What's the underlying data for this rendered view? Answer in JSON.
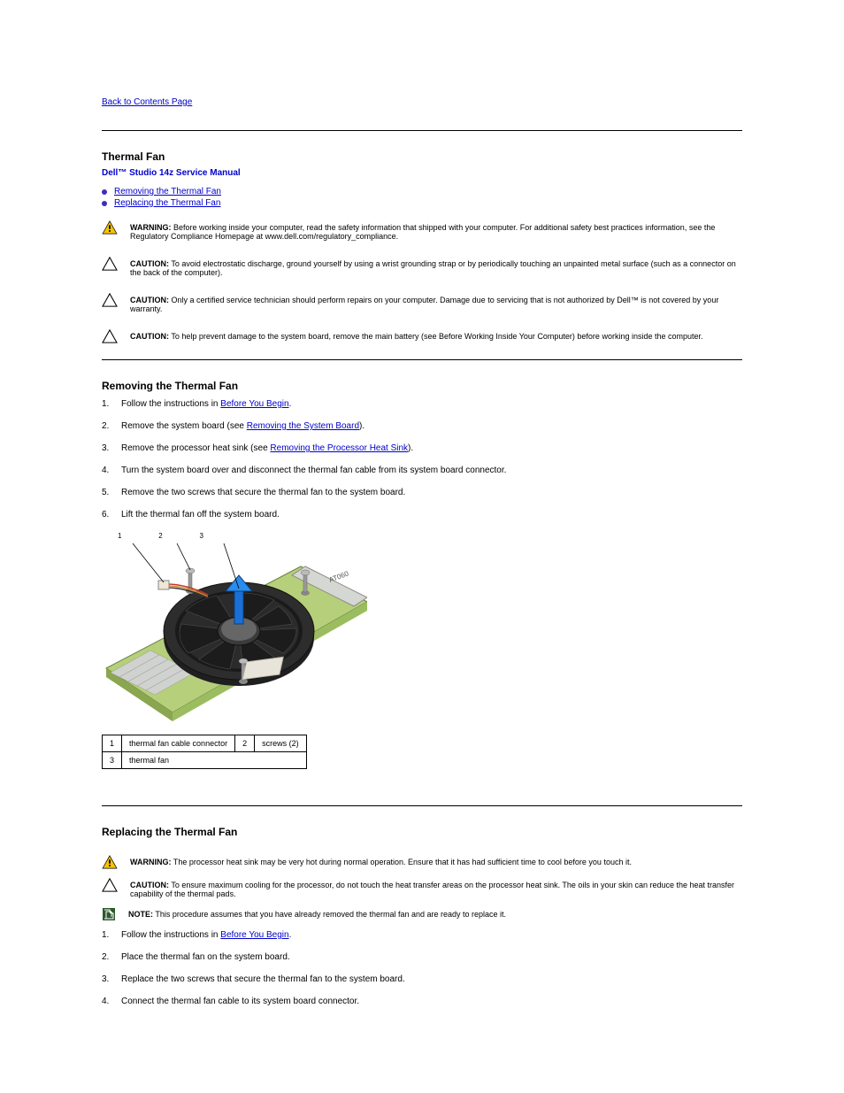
{
  "nav": {
    "back": "Back to Contents Page"
  },
  "header": {
    "page_title": "Thermal Fan",
    "manual": "Dell™ Studio 14z Service Manual"
  },
  "toc": {
    "items": [
      {
        "label": "Removing the Thermal Fan"
      },
      {
        "label": "Replacing the Thermal Fan"
      }
    ]
  },
  "alerts": {
    "warn1": {
      "lead": "WARNING:",
      "body": "Before working inside your computer, read the safety information that shipped with your computer. For additional safety best practices information, see the Regulatory Compliance Homepage at www.dell.com/regulatory_compliance."
    },
    "caution1": {
      "lead": "CAUTION:",
      "body": "To avoid electrostatic discharge, ground yourself by using a wrist grounding strap or by periodically touching an unpainted metal surface (such as a connector on the back of the computer)."
    },
    "caution2": {
      "lead": "CAUTION:",
      "body": "Only a certified service technician should perform repairs on your computer. Damage due to servicing that is not authorized by Dell™ is not covered by your warranty."
    },
    "caution3": {
      "lead": "CAUTION:",
      "body": "To help prevent damage to the system board, remove the main battery (see Before Working Inside Your Computer) before working inside the computer."
    },
    "warn2": {
      "lead": "WARNING:",
      "body": "The processor heat sink may be very hot during normal operation. Ensure that it has had sufficient time to cool before you touch it."
    },
    "caution4": {
      "lead": "CAUTION:",
      "body": "To ensure maximum cooling for the processor, do not touch the heat transfer areas on the processor heat sink. The oils in your skin can reduce the heat transfer capability of the thermal pads."
    },
    "note1": {
      "lead": "NOTE:",
      "body": "This procedure assumes that you have already removed the thermal fan and are ready to replace it."
    }
  },
  "section1": {
    "title": "Removing the Thermal Fan",
    "steps": [
      {
        "num": "1.",
        "pre": "Follow the instructions in ",
        "link": "Before You Begin",
        "post": "."
      },
      {
        "num": "2.",
        "pre": "Remove the system board (see ",
        "link": "Removing the System Board",
        "post": ")."
      },
      {
        "num": "3.",
        "pre": "Remove the processor heat sink (see ",
        "link": "Removing the Processor Heat Sink",
        "post": ")."
      },
      {
        "num": "4.",
        "pre": "Turn the system board over and disconnect the thermal fan cable from its system board connector."
      },
      {
        "num": "5.",
        "pre": "Remove the two screws that secure the thermal fan to the system board."
      },
      {
        "num": "6.",
        "pre": "Lift the thermal fan off the system board."
      }
    ]
  },
  "legend": {
    "rows": [
      [
        "1",
        "thermal fan cable connector",
        "2",
        "screws (2)"
      ],
      [
        "3",
        "thermal fan",
        "",
        ""
      ]
    ]
  },
  "callouts": {
    "c1": "1",
    "c2": "2",
    "c3": "3"
  },
  "section2": {
    "title": "Replacing the Thermal Fan",
    "steps": [
      {
        "num": "1.",
        "pre": "Follow the instructions in ",
        "link": "Before You Begin",
        "post": "."
      },
      {
        "num": "2.",
        "pre": "Place the thermal fan on the system board."
      },
      {
        "num": "3.",
        "pre": "Replace the two screws that secure the thermal fan to the system board."
      },
      {
        "num": "4.",
        "pre": "Connect the thermal fan cable to its system board connector."
      }
    ]
  }
}
